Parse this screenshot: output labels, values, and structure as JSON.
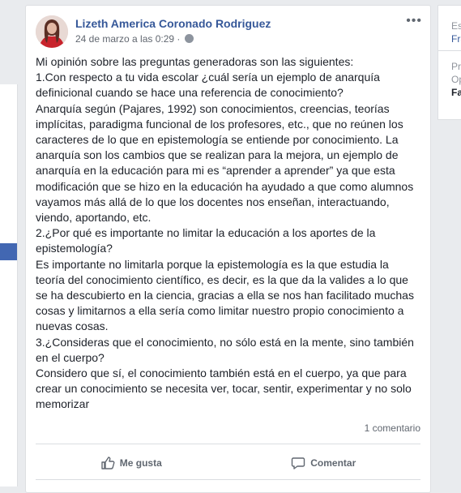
{
  "post": {
    "author": "Lizeth America Coronado Rodriguez",
    "timestamp": "24 de marzo a las 0:29",
    "privacy_dot": "·",
    "menu": "•••",
    "body": "Mi opinión sobre las preguntas generadoras son las siguientes:\n1.Con respecto a tu vida escolar ¿cuál sería un ejemplo de anarquía definicional cuando se hace una referencia de conocimiento?\nAnarquía según (Pajares, 1992) son conocimientos, creencias, teorías implícitas, paradigma funcional de los profesores, etc., que no reúnen los caracteres de lo que en epistemología se entiende por conocimiento. La anarquía son los cambios que se realizan para la mejora, un ejemplo de anarquía en la educación para mi es “aprender a aprender” ya que esta modificación que se hizo en la educación ha ayudado a que como alumnos vayamos más allá de lo que los docentes nos enseñan, interactuando, viendo, aportando, etc.\n2.¿Por qué es importante no limitar la educación a los aportes de la epistemología?\nEs importante no limitarla porque la epistemología es la que estudia la teoría del conocimiento científico, es decir, es la que da la valides a lo que se ha descubierto en la ciencia, gracias a ella se nos han facilitado muchas cosas y limitarnos a ella sería como limitar nuestro propio conocimiento a nuevas cosas.\n3.¿Consideras que el conocimiento, no sólo está en la mente, sino también en el cuerpo?\nConsidero que sí, el conocimiento también está en el cuerpo, ya que para crear un conocimiento se necesita ver, tocar, sentir, experimentar y no solo memorizar",
    "comments_count": "1 comentario",
    "like_label": "Me gusta",
    "comment_label": "Comentar"
  },
  "sidebar_right": {
    "line1": "Es",
    "line2": "Fra",
    "line3": "Pr",
    "line4": "Op",
    "line5": "Fa"
  },
  "colors": {
    "link": "#365899",
    "page_bg": "#e9ebee",
    "fb_blue": "#4267b2"
  }
}
